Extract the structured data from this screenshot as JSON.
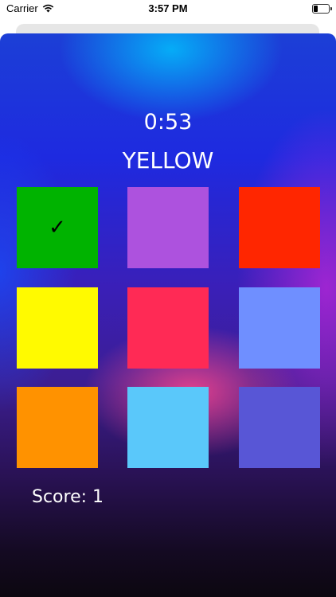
{
  "status_bar": {
    "carrier": "Carrier",
    "time": "3:57 PM"
  },
  "game": {
    "timer": "0:53",
    "target_word": "YELLOW",
    "score_label": "Score: 1",
    "tiles": [
      {
        "color": "#00b300",
        "checked": true,
        "check_mark": "✓"
      },
      {
        "color": "#ad52de",
        "checked": false
      },
      {
        "color": "#ff2600",
        "checked": false
      },
      {
        "color": "#fffa00",
        "checked": false
      },
      {
        "color": "#ff2a55",
        "checked": false
      },
      {
        "color": "#6f8fff",
        "checked": false
      },
      {
        "color": "#ff9200",
        "checked": false
      },
      {
        "color": "#5ac8fa",
        "checked": false
      },
      {
        "color": "#5856d6",
        "checked": false
      }
    ]
  }
}
